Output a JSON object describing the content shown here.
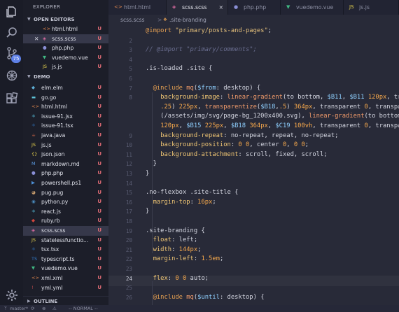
{
  "activity_bar": {
    "icons": [
      "files-icon",
      "search-icon",
      "source-control-icon",
      "debug-icon",
      "extensions-icon",
      "settings-icon"
    ],
    "scm_badge": "75"
  },
  "sidebar": {
    "title": "EXPLORER",
    "open_editors": {
      "label": "OPEN EDITORS",
      "items": [
        {
          "icon": "<>",
          "name": "html.html",
          "status": "U",
          "selected": false
        },
        {
          "icon": "css",
          "name": "scss.scss",
          "status": "U",
          "selected": true
        },
        {
          "icon": "php",
          "name": "php.php",
          "status": "U",
          "selected": false
        },
        {
          "icon": "vue",
          "name": "vuedemo.vue",
          "status": "U",
          "selected": false
        },
        {
          "icon": "js",
          "name": "js.js",
          "status": "U",
          "selected": false
        }
      ]
    },
    "demo": {
      "label": "DEMO",
      "items": [
        {
          "icon": "elm",
          "name": "elm.elm",
          "status": "U",
          "selected": false
        },
        {
          "icon": "go",
          "name": "go.go",
          "status": "U",
          "selected": false
        },
        {
          "icon": "<>",
          "name": "html.html",
          "status": "U",
          "selected": false
        },
        {
          "icon": "jsx",
          "name": "issue-91.jsx",
          "status": "U",
          "selected": false
        },
        {
          "icon": "tsx",
          "name": "issue-91.tsx",
          "status": "U",
          "selected": false
        },
        {
          "icon": "java",
          "name": "java.java",
          "status": "U",
          "selected": false
        },
        {
          "icon": "js",
          "name": "js.js",
          "status": "U",
          "selected": false
        },
        {
          "icon": "{}",
          "name": "json.json",
          "status": "U",
          "selected": false
        },
        {
          "icon": "md",
          "name": "markdown.md",
          "status": "U",
          "selected": false
        },
        {
          "icon": "php",
          "name": "php.php",
          "status": "U",
          "selected": false
        },
        {
          "icon": "ps",
          "name": "powershell.ps1",
          "status": "U",
          "selected": false
        },
        {
          "icon": "pug",
          "name": "pug.pug",
          "status": "U",
          "selected": false
        },
        {
          "icon": "py",
          "name": "python.py",
          "status": "U",
          "selected": false
        },
        {
          "icon": "react",
          "name": "react.js",
          "status": "U",
          "selected": false
        },
        {
          "icon": "rb",
          "name": "ruby.rb",
          "status": "U",
          "selected": false
        },
        {
          "icon": "css",
          "name": "scss.scss",
          "status": "U",
          "selected": true
        },
        {
          "icon": "js",
          "name": "statelessfunctio...",
          "status": "U",
          "selected": false
        },
        {
          "icon": "tsx",
          "name": "tsx.tsx",
          "status": "U",
          "selected": false
        },
        {
          "icon": "ts",
          "name": "typescript.ts",
          "status": "U",
          "selected": false
        },
        {
          "icon": "vue",
          "name": "vuedemo.vue",
          "status": "U",
          "selected": false
        },
        {
          "icon": "xml",
          "name": "xml.xml",
          "status": "U",
          "selected": false
        },
        {
          "icon": "yml",
          "name": "yml.yml",
          "status": "U",
          "selected": false
        }
      ]
    },
    "outline_label": "OUTLINE"
  },
  "tabs": [
    {
      "icon": "<>",
      "label": "html.html",
      "active": false
    },
    {
      "icon": "css",
      "label": "scss.scss",
      "active": true,
      "close": "×"
    },
    {
      "icon": "php",
      "label": "php.php",
      "active": false
    },
    {
      "icon": "vue",
      "label": "vuedemo.vue",
      "active": false
    },
    {
      "icon": "JS",
      "label": "js.js",
      "active": false
    }
  ],
  "breadcrumb": {
    "file": "scss.scss",
    "separator": ">",
    "symbol": ".site-branding"
  },
  "editor": {
    "current_line": "24",
    "lines": [
      {
        "n": "",
        "code": "@import \"primary/posts-and-pages\";"
      },
      {
        "n": "2",
        "code": ""
      },
      {
        "n": "3",
        "code": "// @import \"primary/comments\";"
      },
      {
        "n": "4",
        "code": ""
      },
      {
        "n": "5",
        "code": ".is-loaded .site {"
      },
      {
        "n": "6",
        "code": ""
      },
      {
        "n": "7",
        "code": "  @include mq($from: desktop) {"
      },
      {
        "n": "8",
        "code": "    background-image: linear-gradient(to bottom, $B11, $B11 120px, transp"
      },
      {
        "n": "",
        "code": "    .25) 225px, transparentize($B18,.5) 364px, transparent 0, transparent 1"
      },
      {
        "n": "",
        "code": "    (/assets/img/svg/page-bg_1200x400.svg), linear-gradient(to bottom, $B1"
      },
      {
        "n": "",
        "code": "    120px, $B15 225px, $B18 364px, $C19 100vh, transparent 0, transparent"
      },
      {
        "n": "9",
        "code": "    background-repeat: no-repeat, repeat, no-repeat;"
      },
      {
        "n": "10",
        "code": "    background-position: 0 0, center 0, 0 0;"
      },
      {
        "n": "11",
        "code": "    background-attachment: scroll, fixed, scroll;"
      },
      {
        "n": "12",
        "code": "  }"
      },
      {
        "n": "13",
        "code": "}"
      },
      {
        "n": "14",
        "code": ""
      },
      {
        "n": "15",
        "code": ".no-flexbox .site-title {"
      },
      {
        "n": "16",
        "code": "  margin-top: 16px;"
      },
      {
        "n": "17",
        "code": "}"
      },
      {
        "n": "18",
        "code": ""
      },
      {
        "n": "19",
        "code": ".site-branding {"
      },
      {
        "n": "20",
        "code": "  float: left;"
      },
      {
        "n": "21",
        "code": "  width: 144px;"
      },
      {
        "n": "22",
        "code": "  margin-left: 1.5em;"
      },
      {
        "n": "23",
        "code": ""
      },
      {
        "n": "24",
        "code": "  flex: 0 0 auto;"
      },
      {
        "n": "25",
        "code": ""
      },
      {
        "n": "26",
        "code": "  @include mq($until: desktop) {"
      }
    ]
  },
  "status_bar": {
    "branch": "master*",
    "mode": "-- NORMAL --"
  },
  "colors": {
    "accent": "#5e80e7",
    "untracked": "#e06c75",
    "editor_bg": "#282a38"
  }
}
